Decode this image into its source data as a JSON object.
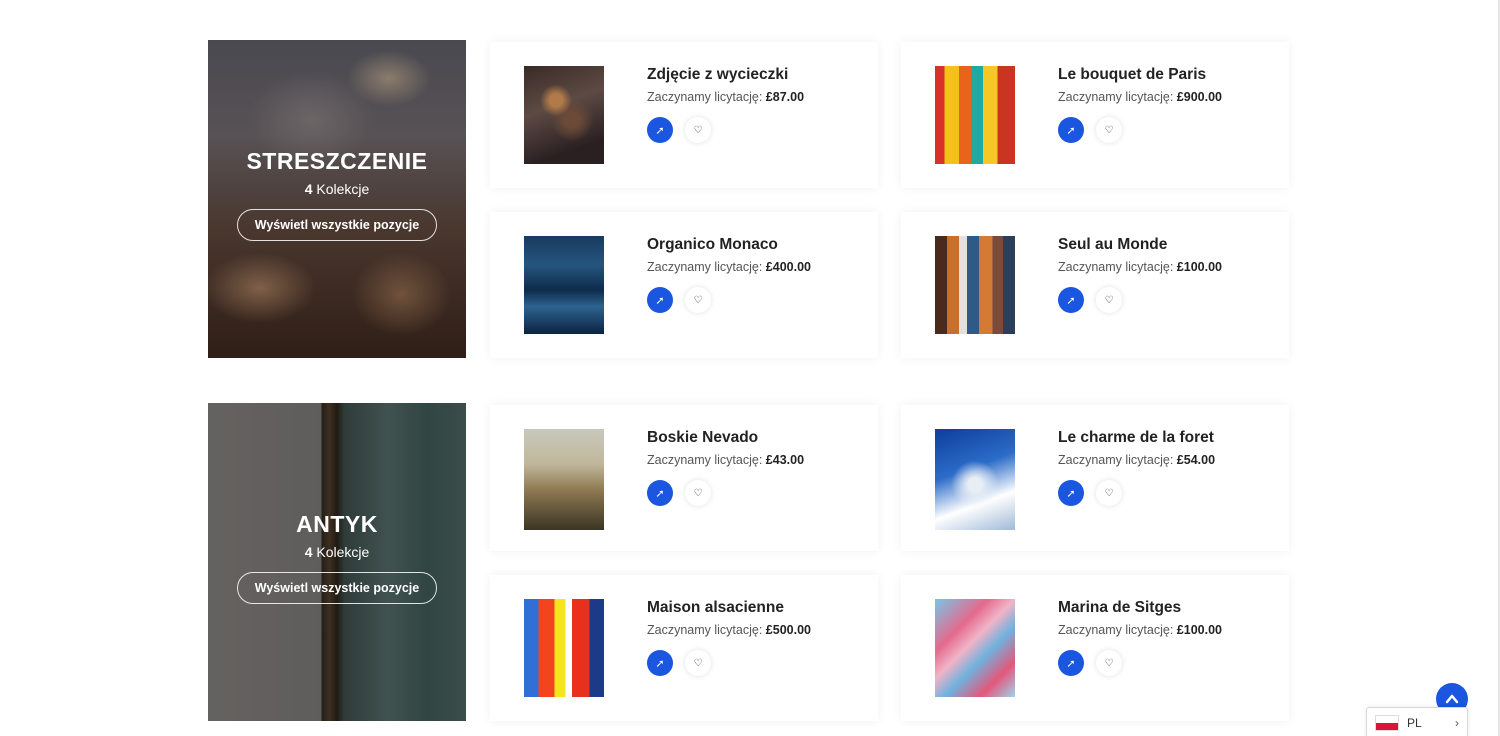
{
  "sections": [
    {
      "category": {
        "title": "STRESZCZENIE",
        "count": "4",
        "count_label": " Kolekcje",
        "button_label": "Wyświetl wszystkie pozycje"
      },
      "items": [
        {
          "title": "Zdjęcie z wycieczki",
          "bid_label": "Zaczynamy licytację:",
          "price": "£87.00"
        },
        {
          "title": "Le bouquet de Paris",
          "bid_label": "Zaczynamy licytację:",
          "price": "£900.00"
        },
        {
          "title": "Organico Monaco",
          "bid_label": "Zaczynamy licytację:",
          "price": "£400.00"
        },
        {
          "title": "Seul au Monde",
          "bid_label": "Zaczynamy licytację:",
          "price": "£100.00"
        }
      ]
    },
    {
      "category": {
        "title": "ANTYK",
        "count": "4",
        "count_label": " Kolekcje",
        "button_label": "Wyświetl wszystkie pozycje"
      },
      "items": [
        {
          "title": "Boskie Nevado",
          "bid_label": "Zaczynamy licytację:",
          "price": "£43.00"
        },
        {
          "title": "Le charme de la foret",
          "bid_label": "Zaczynamy licytację:",
          "price": "£54.00"
        },
        {
          "title": "Maison alsacienne",
          "bid_label": "Zaczynamy licytację:",
          "price": "£500.00"
        },
        {
          "title": "Marina de Sitges",
          "bid_label": "Zaczynamy licytację:",
          "price": "£100.00"
        }
      ]
    }
  ],
  "language": {
    "code": "PL",
    "flag": "poland-flag-icon"
  },
  "colors": {
    "accent": "#1a56e0"
  },
  "icons": {
    "bid": "gavel-icon",
    "wishlist": "heart-icon",
    "scroll_top": "chevron-up-icon"
  }
}
